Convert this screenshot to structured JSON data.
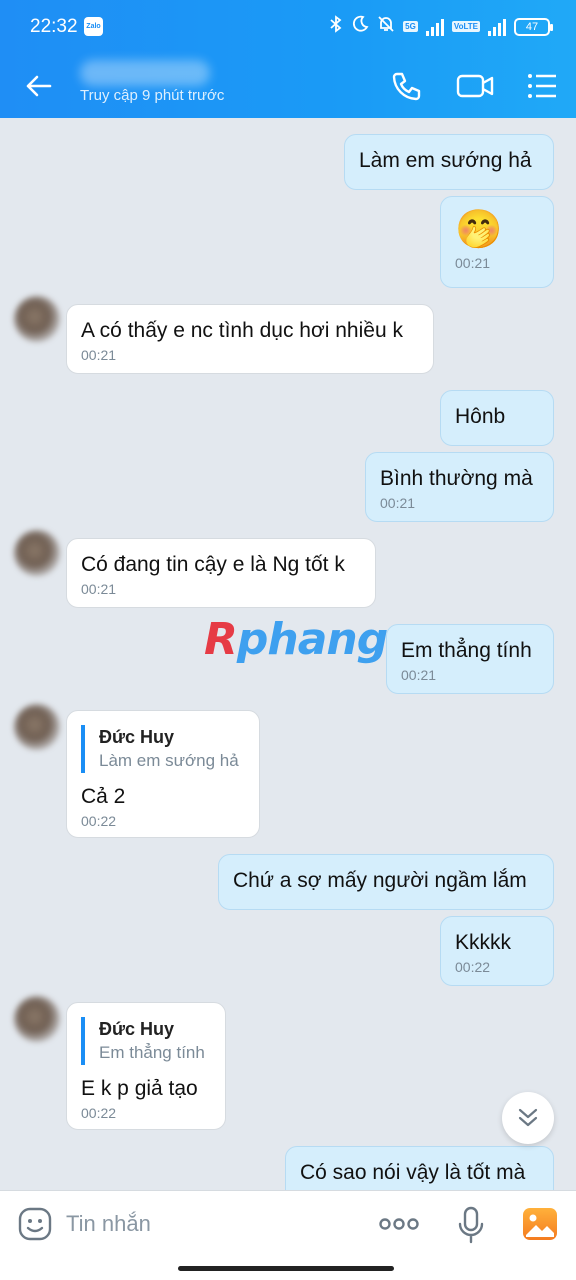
{
  "status_bar": {
    "time": "22:32",
    "app_badge": "Zalo",
    "network": "5G",
    "volte": "VoLTE",
    "battery": "47"
  },
  "header": {
    "last_seen": "Truy cập 9 phút trước"
  },
  "messages": [
    {
      "dir": "out",
      "text": "Làm em sướng hả"
    },
    {
      "dir": "out",
      "emoji": "🤭",
      "time": "00:21"
    },
    {
      "dir": "in",
      "text": "A có thấy e nc tình dục hơi nhiều k",
      "time": "00:21"
    },
    {
      "dir": "out",
      "text": "Hônb"
    },
    {
      "dir": "out",
      "text": "Bình thường mà",
      "time": "00:21"
    },
    {
      "dir": "in",
      "text": "Có đang tin cậy e là Ng tốt k",
      "time": "00:21"
    },
    {
      "dir": "out",
      "text": "Em thẳng tính",
      "time": "00:21"
    },
    {
      "dir": "in",
      "quote_name": "Đức Huy",
      "quote_text": "Làm em sướng hả",
      "text": "Cả 2",
      "time": "00:22"
    },
    {
      "dir": "out",
      "text": "Chứ a sợ mấy người ngầm lắm"
    },
    {
      "dir": "out",
      "text": "Kkkkk",
      "time": "00:22"
    },
    {
      "dir": "in",
      "quote_name": "Đức Huy",
      "quote_text": "Em thẳng tính",
      "text": "E k p giả tạo",
      "time": "00:22"
    },
    {
      "dir": "out",
      "text": "Có sao nói vậy là tốt mà"
    }
  ],
  "watermark": {
    "first": "R",
    "rest": "phang"
  },
  "input": {
    "placeholder": "Tin nhắn"
  },
  "colors": {
    "header": "#1a8ef5",
    "out_bubble": "#d5eefc",
    "in_bubble": "#ffffff",
    "background": "#e3e8ee"
  }
}
